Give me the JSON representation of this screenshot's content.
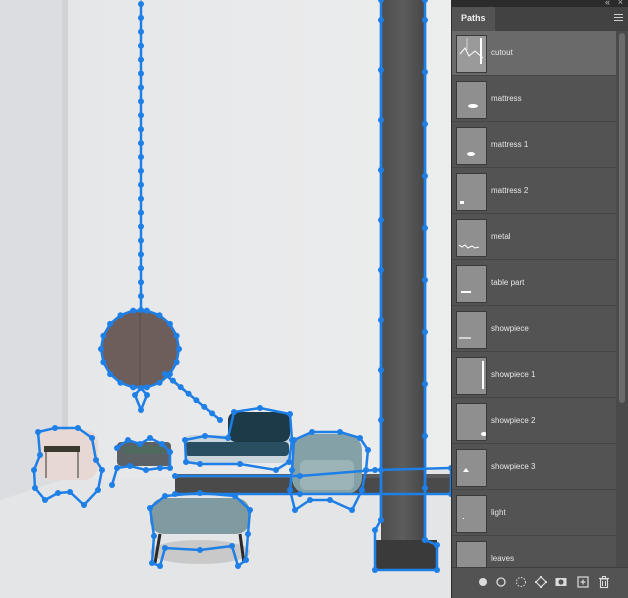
{
  "panel": {
    "tab_label": "Paths",
    "menu_icon": "hamburger-menu-icon",
    "collapse_icon": "double-chevron-icon",
    "close_icon": "close-icon",
    "selected_index": 0,
    "paths": [
      {
        "name": "cutout"
      },
      {
        "name": "mattress"
      },
      {
        "name": "mattress 1"
      },
      {
        "name": "mattress 2"
      },
      {
        "name": "metal"
      },
      {
        "name": "table part"
      },
      {
        "name": "showpiece"
      },
      {
        "name": "showpiece 1"
      },
      {
        "name": "showpiece 2"
      },
      {
        "name": "showpiece 3"
      },
      {
        "name": "light"
      },
      {
        "name": "leaves"
      }
    ],
    "bottom_icons": [
      "fill-path-icon",
      "stroke-path-icon",
      "load-selection-icon",
      "make-work-path-icon",
      "add-mask-icon",
      "new-path-icon",
      "delete-path-icon"
    ]
  },
  "colors": {
    "path_outline": "#1e7fe6",
    "panel_bg": "#535353",
    "selected_row": "#6a6a6a"
  }
}
